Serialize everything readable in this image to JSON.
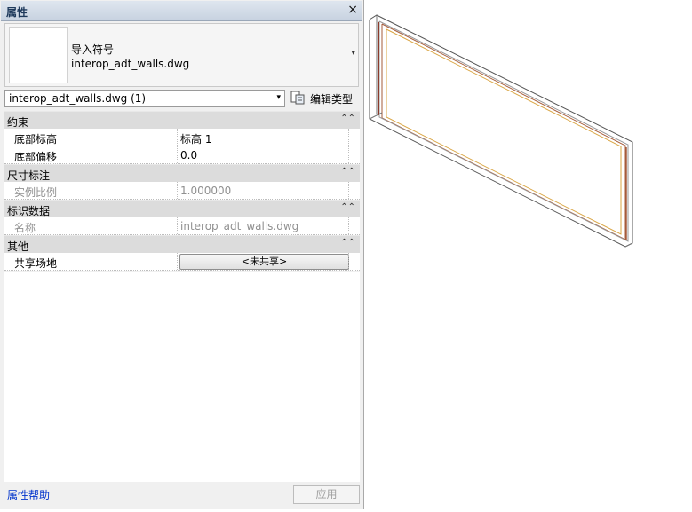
{
  "palette": {
    "title_text": "#1e395b",
    "link": "#0033cc",
    "section_bg": "#dcdcdc",
    "wall_line": "#a65b3a",
    "wall_accent": "#d9a441"
  },
  "panel": {
    "title": "属性",
    "close_icon": "×",
    "preview": {
      "line1": "导入符号",
      "line2": "interop_adt_walls.dwg",
      "dropdown_icon": "▾"
    },
    "selector": {
      "value": "interop_adt_walls.dwg (1)",
      "arrow_icon": "▾"
    },
    "edit_type": {
      "label": "编辑类型",
      "icon": "edit-type-icon"
    },
    "sections": [
      {
        "title": "约束",
        "collapse_icon": "⌃⌃",
        "rows": [
          {
            "key": "底部标高",
            "value": "标高 1"
          },
          {
            "key": "底部偏移",
            "value": "0.0"
          }
        ]
      },
      {
        "title": "尺寸标注",
        "collapse_icon": "⌃⌃",
        "rows": [
          {
            "key": "实例比例",
            "value": "1.000000"
          }
        ]
      },
      {
        "title": "标识数据",
        "collapse_icon": "⌃⌃",
        "rows": [
          {
            "key": "名称",
            "value": "interop_adt_walls.dwg"
          }
        ]
      },
      {
        "title": "其他",
        "collapse_icon": "⌃⌃",
        "rows": [
          {
            "key": "共享场地",
            "value": "<未共享>"
          }
        ]
      }
    ],
    "footer": {
      "help": "属性帮助",
      "apply": "应用"
    }
  }
}
